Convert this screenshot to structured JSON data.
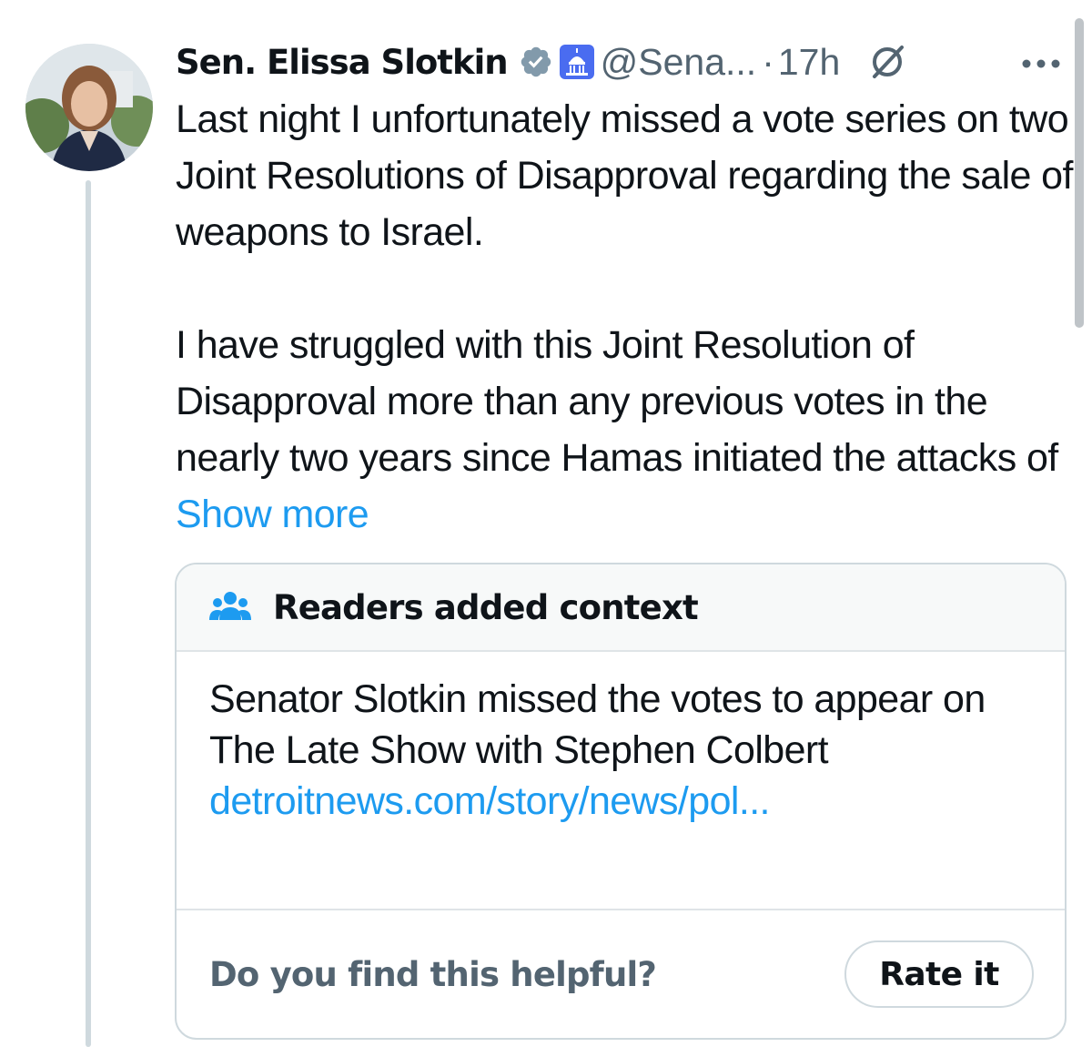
{
  "tweet": {
    "author_name": "Sen. Elissa Slotkin",
    "handle": "@Sena...",
    "separator": "·",
    "timestamp": "17h",
    "paragraphs": [
      "Last night I unfortunately missed a vote series on two Joint Resolutions of Disapproval regarding the sale of weapons to Israel.",
      "I have struggled with this Joint Resolution of Disapproval more than any previous votes in the nearly two years since Hamas initiated the attacks of"
    ],
    "show_more": "Show more"
  },
  "community_note": {
    "title": "Readers added context",
    "body": "Senator Slotkin missed the votes to appear on The Late Show with Stephen Colbert",
    "link": "detroitnews.com/story/news/pol...",
    "question": "Do you find this helpful?",
    "rate_button": "Rate it"
  },
  "icons": {
    "verified": "verified-badge-icon",
    "affiliate": "capitol-badge-icon",
    "grok": "grok-icon",
    "more": "more-options-icon",
    "people": "people-icon"
  },
  "colors": {
    "text": "#0f1419",
    "secondary": "#536471",
    "link": "#1d9bf0",
    "border": "#cfd9de",
    "verified_gray": "#829aab",
    "affiliate_blue": "#4a6cf0"
  }
}
